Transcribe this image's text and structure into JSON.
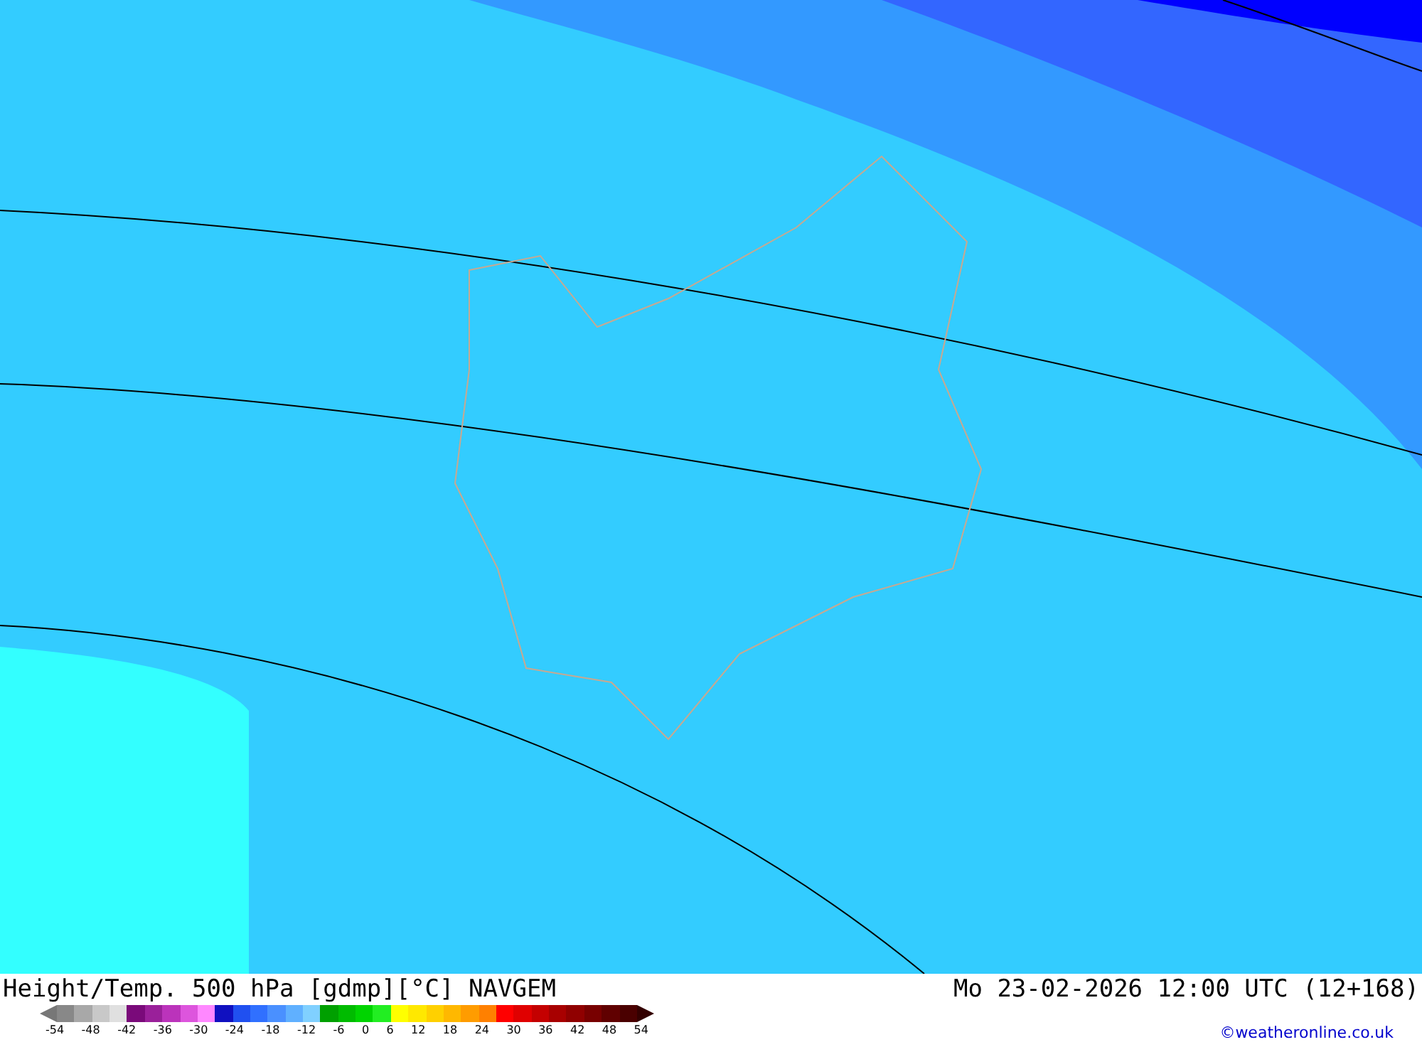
{
  "map": {
    "kind": "temperature-map"
  },
  "footer": {
    "title": "Height/Temp. 500 hPa [gdmp][°C] NAVGEM",
    "datetime": "Mo 23-02-2026 12:00 UTC (12+168)",
    "credit": "©weatheronline.co.uk"
  },
  "legend": {
    "ticks": [
      "-54",
      "-48",
      "-42",
      "-36",
      "-30",
      "-24",
      "-18",
      "-12",
      "-6",
      "0",
      "6",
      "12",
      "18",
      "24",
      "30",
      "36",
      "42",
      "48",
      "54"
    ],
    "swatches": [
      {
        "color": "#888888"
      },
      {
        "color": "#a8a8a8"
      },
      {
        "color": "#c8c8c8"
      },
      {
        "color": "#e0e0e0"
      },
      {
        "color": "#7a0a7a"
      },
      {
        "color": "#9a209a"
      },
      {
        "color": "#bb33bb"
      },
      {
        "color": "#dd55dd"
      },
      {
        "color": "#ff88ff"
      },
      {
        "color": "#1010c0"
      },
      {
        "color": "#2050f0"
      },
      {
        "color": "#3070ff"
      },
      {
        "color": "#4a90ff"
      },
      {
        "color": "#60b0ff"
      },
      {
        "color": "#80d0ff"
      },
      {
        "color": "#00a000"
      },
      {
        "color": "#00bb00"
      },
      {
        "color": "#00d400"
      },
      {
        "color": "#22ee22"
      },
      {
        "color": "#ffff00"
      },
      {
        "color": "#ffe800"
      },
      {
        "color": "#ffd000"
      },
      {
        "color": "#ffb800"
      },
      {
        "color": "#ff9c00"
      },
      {
        "color": "#ff8000"
      },
      {
        "color": "#ff0000"
      },
      {
        "color": "#e00000"
      },
      {
        "color": "#c40000"
      },
      {
        "color": "#a80000"
      },
      {
        "color": "#900000"
      },
      {
        "color": "#780000"
      },
      {
        "color": "#600000"
      },
      {
        "color": "#4a0000"
      }
    ]
  }
}
